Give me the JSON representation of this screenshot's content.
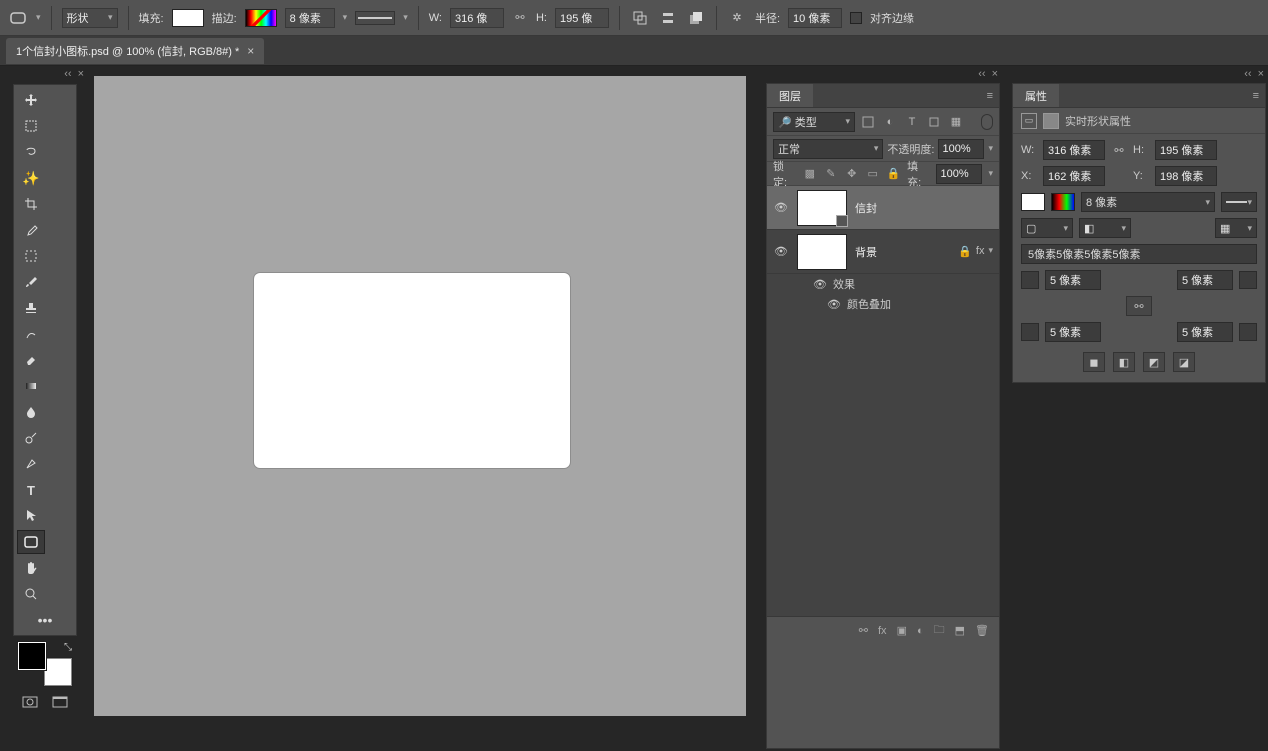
{
  "options": {
    "mode": "形状",
    "fill_label": "填充:",
    "stroke_label": "描边:",
    "stroke_width": "8 像素",
    "w_label": "W:",
    "w_value": "316 像",
    "h_label": "H:",
    "h_value": "195 像",
    "radius_label": "半径:",
    "radius_value": "10 像素",
    "align_edges": "对齐边缘"
  },
  "doc_tab": {
    "title": "1个信封小图标.psd @ 100% (信封, RGB/8#) *"
  },
  "layers": {
    "tab": "图层",
    "filter": "类型",
    "blend_mode": "正常",
    "opacity_label": "不透明度:",
    "opacity_value": "100%",
    "lock_label": "锁定:",
    "fill_label": "填充:",
    "fill_value": "100%",
    "items": [
      {
        "name": "信封"
      },
      {
        "name": "背景"
      }
    ],
    "effects_label": "效果",
    "effect_color_overlay": "颜色叠加"
  },
  "props": {
    "tab": "属性",
    "title": "实时形状属性",
    "w_label": "W:",
    "w_value": "316 像素",
    "h_label": "H:",
    "h_value": "195 像素",
    "x_label": "X:",
    "x_value": "162 像素",
    "y_label": "Y:",
    "y_value": "198 像素",
    "stroke_width": "8 像素",
    "corner_summary": "5像素5像素5像素5像素",
    "corner_val": "5 像素"
  }
}
